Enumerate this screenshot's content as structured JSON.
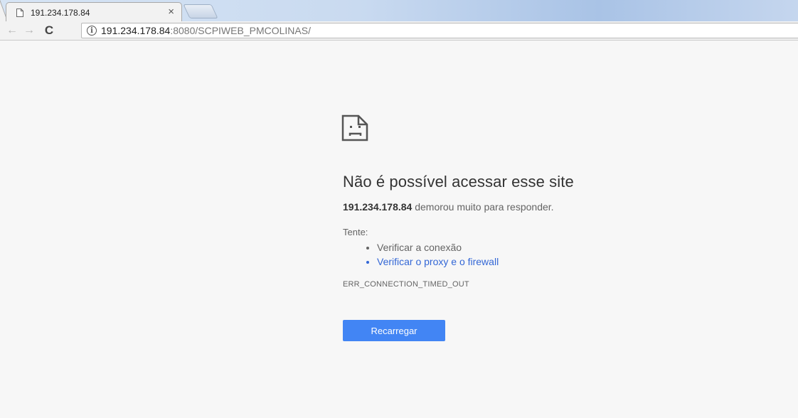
{
  "tab": {
    "title": "191.234.178.84",
    "close_glyph": "×",
    "icon": "page-icon"
  },
  "toolbar": {
    "back_glyph": "←",
    "forward_glyph": "→",
    "reload_glyph": "C",
    "info_glyph": "i",
    "url_host": "191.234.178.84",
    "url_rest": ":8080/SCPIWEB_PMCOLINAS/"
  },
  "error": {
    "icon": "sad-page-icon",
    "heading": "Não é possível acessar esse site",
    "host": "191.234.178.84",
    "message": " demorou muito para responder.",
    "try_label": "Tente:",
    "suggestions": [
      "Verificar a conexão",
      "Verificar o proxy e o firewall"
    ],
    "code": "ERR_CONNECTION_TIMED_OUT",
    "button_label": "Recarregar"
  },
  "colors": {
    "accent": "#4285f4",
    "link": "#3367d6",
    "background": "#f7f7f7"
  }
}
